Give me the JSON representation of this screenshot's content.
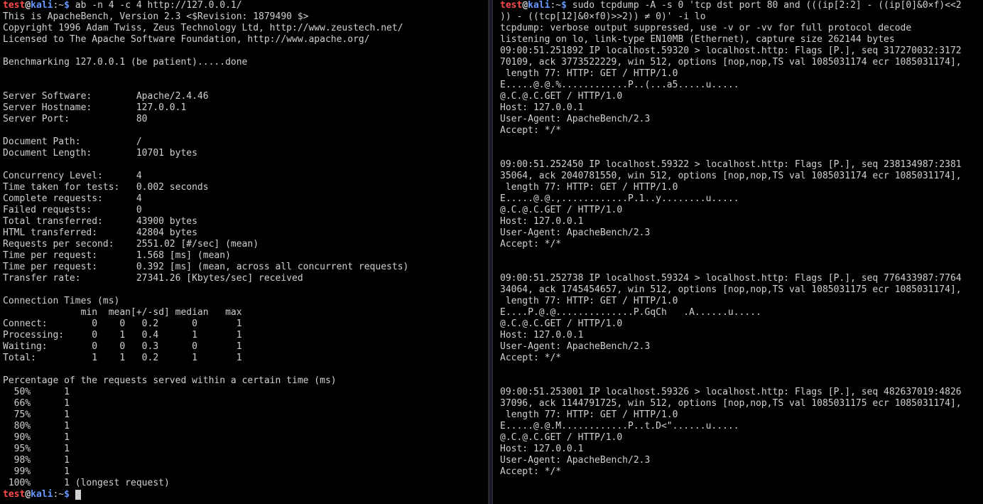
{
  "left": {
    "prompt1": {
      "user": "test",
      "at": "@",
      "host": "kali",
      "path": ":~",
      "dollar": "$ "
    },
    "cmd1": "ab -n 4 -c 4 http://127.0.0.1/",
    "line2": "This is ApacheBench, Version 2.3 <$Revision: 1879490 $>",
    "line3": "Copyright 1996 Adam Twiss, Zeus Technology Ltd, http://www.zeustech.net/",
    "line4": "Licensed to The Apache Software Foundation, http://www.apache.org/",
    "blank1": "",
    "line6": "Benchmarking 127.0.0.1 (be patient).....done",
    "blank2": "",
    "blank3": "",
    "line9": "Server Software:        Apache/2.4.46",
    "line10": "Server Hostname:        127.0.0.1",
    "line11": "Server Port:            80",
    "blank4": "",
    "line13": "Document Path:          /",
    "line14": "Document Length:        10701 bytes",
    "blank5": "",
    "line16": "Concurrency Level:      4",
    "line17": "Time taken for tests:   0.002 seconds",
    "line18": "Complete requests:      4",
    "line19": "Failed requests:        0",
    "line20": "Total transferred:      43900 bytes",
    "line21": "HTML transferred:       42804 bytes",
    "line22": "Requests per second:    2551.02 [#/sec] (mean)",
    "line23": "Time per request:       1.568 [ms] (mean)",
    "line24": "Time per request:       0.392 [ms] (mean, across all concurrent requests)",
    "line25": "Transfer rate:          27341.26 [Kbytes/sec] received",
    "blank6": "",
    "line27": "Connection Times (ms)",
    "line28": "              min  mean[+/-sd] median   max",
    "line29": "Connect:        0    0   0.2      0       1",
    "line30": "Processing:     0    1   0.4      1       1",
    "line31": "Waiting:        0    0   0.3      0       1",
    "line32": "Total:          1    1   0.2      1       1",
    "blank7": "",
    "line34": "Percentage of the requests served within a certain time (ms)",
    "line35": "  50%      1",
    "line36": "  66%      1",
    "line37": "  75%      1",
    "line38": "  80%      1",
    "line39": "  90%      1",
    "line40": "  95%      1",
    "line41": "  98%      1",
    "line42": "  99%      1",
    "line43": " 100%      1 (longest request)",
    "prompt2": {
      "user": "test",
      "at": "@",
      "host": "kali",
      "path": ":~",
      "dollar": "$ "
    }
  },
  "right": {
    "prompt1": {
      "user": "test",
      "at": "@",
      "host": "kali",
      "path": ":~",
      "dollar": "$ "
    },
    "cmd1a": "sudo tcpdump -A -s 0 'tcp dst port 80 and (((ip[2:2] - ((ip[0]&0×f)<<2",
    "cmd1b": ")) - ((tcp[12]&0×f0)>>2)) ≠ 0)' -i lo",
    "line3": "tcpdump: verbose output suppressed, use -v or -vv for full protocol decode",
    "line4": "listening on lo, link-type EN10MB (Ethernet), capture size 262144 bytes",
    "line5": "09:00:51.251892 IP localhost.59320 > localhost.http: Flags [P.], seq 317270032:3172",
    "line6": "70109, ack 3773522229, win 512, options [nop,nop,TS val 1085031174 ecr 1085031174],",
    "line7": " length 77: HTTP: GET / HTTP/1.0",
    "line8": "E.....@.@.%............P..(...a5.....u.....",
    "line9": "@.C.@.C.GET / HTTP/1.0",
    "line10": "Host: 127.0.0.1",
    "line11": "User-Agent: ApacheBench/2.3",
    "line12": "Accept: */*",
    "blank1": "",
    "blank2": "",
    "line15": "09:00:51.252450 IP localhost.59322 > localhost.http: Flags [P.], seq 238134987:2381",
    "line16": "35064, ack 2040781550, win 512, options [nop,nop,TS val 1085031174 ecr 1085031174],",
    "line17": " length 77: HTTP: GET / HTTP/1.0",
    "line18": "E.....@.@.,............P.1..y........u.....",
    "line19": "@.C.@.C.GET / HTTP/1.0",
    "line20": "Host: 127.0.0.1",
    "line21": "User-Agent: ApacheBench/2.3",
    "line22": "Accept: */*",
    "blank3": "",
    "blank4": "",
    "line25": "09:00:51.252738 IP localhost.59324 > localhost.http: Flags [P.], seq 776433987:7764",
    "line26": "34064, ack 1745454657, win 512, options [nop,nop,TS val 1085031175 ecr 1085031174],",
    "line27": " length 77: HTTP: GET / HTTP/1.0",
    "line28": "E....P.@.@..............P.GqCh   .A......u.....",
    "line29": "@.C.@.C.GET / HTTP/1.0",
    "line30": "Host: 127.0.0.1",
    "line31": "User-Agent: ApacheBench/2.3",
    "line32": "Accept: */*",
    "blank5": "",
    "blank6": "",
    "line35": "09:00:51.253001 IP localhost.59326 > localhost.http: Flags [P.], seq 482637019:4826",
    "line36": "37096, ack 1144791725, win 512, options [nop,nop,TS val 1085031175 ecr 1085031174],",
    "line37": " length 77: HTTP: GET / HTTP/1.0",
    "line38": "E.....@.@.M............P..t.D<\"......u.....",
    "line39": "@.C.@.C.GET / HTTP/1.0",
    "line40": "Host: 127.0.0.1",
    "line41": "User-Agent: ApacheBench/2.3",
    "line42": "Accept: */*"
  }
}
